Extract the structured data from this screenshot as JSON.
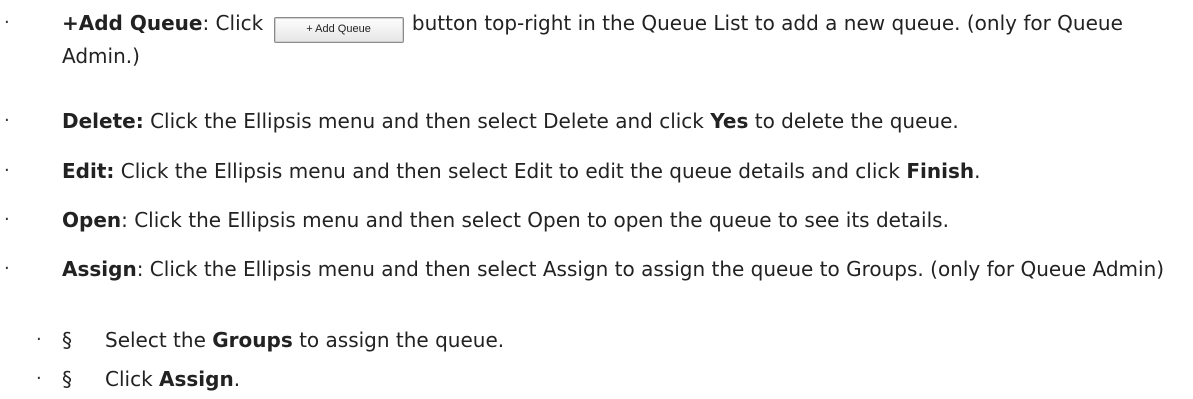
{
  "items": [
    {
      "bullet": "·",
      "term": "+Add Queue",
      "before_button": ": Click ",
      "button_label": "+ Add Queue",
      "after_button": " button top-right in the Queue List to add a new queue. (only for Queue Admin.)"
    },
    {
      "bullet": "·",
      "term": "Delete:",
      "text": " Click the Ellipsis menu and then select Delete and click ",
      "bold_end": "Yes",
      "tail": " to delete the queue."
    },
    {
      "bullet": "·",
      "term": "Edit:",
      "text": " Click the Ellipsis menu and then select Edit to edit the queue details and click ",
      "bold_end": "Finish",
      "tail": "."
    },
    {
      "bullet": "·",
      "term": "Open",
      "text": ": Click the Ellipsis menu and then select Open to open the queue to see its details."
    },
    {
      "bullet": "·",
      "term": "Assign",
      "text": ": Click the Ellipsis menu and then select Assign to assign the queue to Groups. (only for Queue Admin)"
    }
  ],
  "subitems": [
    {
      "bullet": "·",
      "mark": "§",
      "before": "Select the ",
      "bold": "Groups",
      "after": " to assign the queue."
    },
    {
      "bullet": "·",
      "mark": "§",
      "before": "Click ",
      "bold": "Assign",
      "after": "."
    }
  ]
}
